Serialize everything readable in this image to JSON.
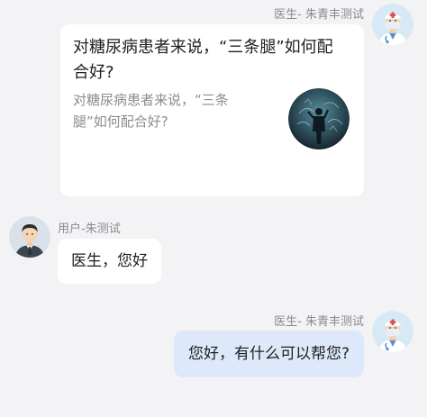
{
  "messages": [
    {
      "side": "right",
      "sender": "医生- 朱青丰测试",
      "avatar_icon": "doctor-avatar-icon",
      "type": "article-card",
      "card": {
        "title": "对糖尿病患者来说，“三条腿”如何配合好?",
        "description": "对糖尿病患者来说，“三条腿”如何配合好?",
        "thumbnail_icon": "man-silhouette-thumbnail-icon"
      }
    },
    {
      "side": "left",
      "sender": "用户-朱测试",
      "avatar_icon": "user-avatar-icon",
      "type": "text",
      "text": "医生，您好"
    },
    {
      "side": "right",
      "sender": "医生- 朱青丰测试",
      "avatar_icon": "doctor-avatar-icon",
      "type": "text",
      "text": "您好，有什么可以帮您?"
    }
  ],
  "colors": {
    "background": "#f3f3f5",
    "bubble_white": "#ffffff",
    "bubble_self": "#dde9fb",
    "sender_text": "#8a8a8e",
    "secondary_text": "#8c8c90"
  }
}
